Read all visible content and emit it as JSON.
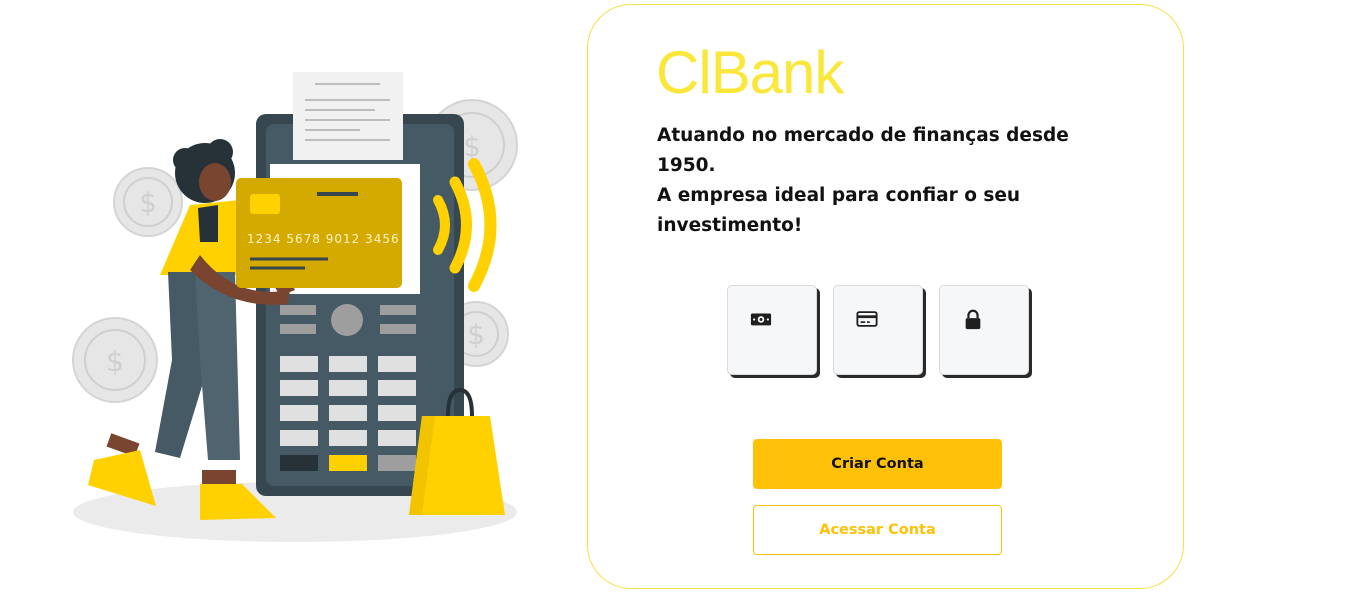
{
  "brand": {
    "name": "ClBank",
    "color": "#fbe63a"
  },
  "hero": {
    "tagline_lines": [
      "Atuando no mercado de finanças desde 1950.",
      "A empresa ideal para confiar o seu",
      "investimento!"
    ]
  },
  "illustration": {
    "card_number": "1234  5678  9012  3456"
  },
  "features": [
    {
      "icon": "money-icon"
    },
    {
      "icon": "credit-card-icon"
    },
    {
      "icon": "lock-icon"
    }
  ],
  "actions": {
    "create_account": "Criar Conta",
    "access_account": "Acessar Conta"
  },
  "colors": {
    "accent": "#ffc107",
    "brand_yellow": "#fbe63a",
    "illustration_yellow": "#ffd100",
    "terminal_dark": "#37474f"
  }
}
